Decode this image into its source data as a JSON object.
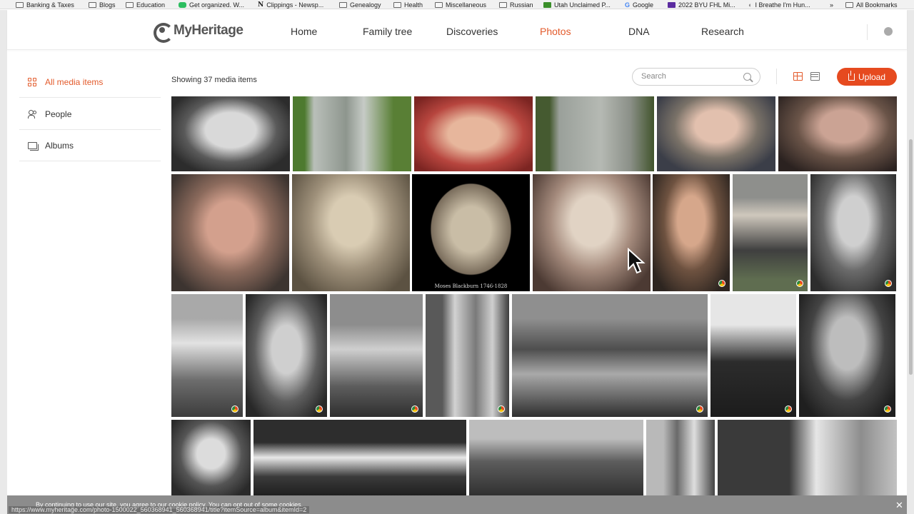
{
  "bookmarks": [
    {
      "label": "Banking & Taxes",
      "icon": "folder-icon"
    },
    {
      "label": "Blogs",
      "icon": "folder-icon"
    },
    {
      "label": "Education",
      "icon": "folder-icon"
    },
    {
      "label": "Get organized. W...",
      "icon": "evernote-icon"
    },
    {
      "label": "Clippings - Newsp...",
      "icon": "newspapers-icon"
    },
    {
      "label": "Genealogy",
      "icon": "folder-icon"
    },
    {
      "label": "Health",
      "icon": "folder-icon"
    },
    {
      "label": "Miscellaneous",
      "icon": "folder-icon"
    },
    {
      "label": "Russian",
      "icon": "folder-icon"
    },
    {
      "label": "Utah Unclaimed P...",
      "icon": "utah-icon"
    },
    {
      "label": "Google",
      "icon": "google-icon"
    },
    {
      "label": "2022 BYU FHL Mi...",
      "icon": "byu-icon"
    },
    {
      "label": "I Breathe I'm Hun...",
      "icon": "site-icon"
    },
    {
      "label": "»",
      "icon": ""
    },
    {
      "label": "All Bookmarks",
      "icon": "folder-icon"
    }
  ],
  "header": {
    "brand": "MyHeritage",
    "nav": [
      {
        "label": "Home",
        "active": false
      },
      {
        "label": "Family tree",
        "active": false
      },
      {
        "label": "Discoveries",
        "active": false
      },
      {
        "label": "Photos",
        "active": true
      },
      {
        "label": "DNA",
        "active": false
      },
      {
        "label": "Research",
        "active": false
      }
    ]
  },
  "sidebar": {
    "items": [
      {
        "label": "All media items",
        "icon": "grid-icon",
        "active": true
      },
      {
        "label": "People",
        "icon": "people-icon",
        "active": false
      },
      {
        "label": "Albums",
        "icon": "albums-icon",
        "active": false
      }
    ]
  },
  "toolbar": {
    "showing_text": "Showing 37 media items",
    "search_placeholder": "Search",
    "upload_label": "Upload"
  },
  "photos": [
    {
      "caption": "",
      "colorized": false,
      "tone": "bw-portrait"
    },
    {
      "caption": "",
      "colorized": false,
      "tone": "gravestone"
    },
    {
      "caption": "",
      "colorized": false,
      "tone": "color-child"
    },
    {
      "caption": "",
      "colorized": false,
      "tone": "gravestone-text"
    },
    {
      "caption": "",
      "colorized": false,
      "tone": "color-old-man"
    },
    {
      "caption": "",
      "colorized": false,
      "tone": "color-woman"
    },
    {
      "caption": "",
      "colorized": false,
      "tone": "color-man-glasses"
    },
    {
      "caption": "",
      "colorized": false,
      "tone": "sepia-old-man"
    },
    {
      "caption": "Moses Blackburn 1746-1828",
      "colorized": false,
      "tone": "oval-portrait"
    },
    {
      "caption": "",
      "colorized": false,
      "tone": "sepia-old-woman"
    },
    {
      "caption": "",
      "colorized": true,
      "tone": "color-young-woman"
    },
    {
      "caption": "",
      "colorized": true,
      "tone": "color-standing-woman"
    },
    {
      "caption": "",
      "colorized": true,
      "tone": "bw-man"
    },
    {
      "caption": "",
      "colorized": true,
      "tone": "bw-child"
    },
    {
      "caption": "",
      "colorized": true,
      "tone": "bw-soldier"
    },
    {
      "caption": "",
      "colorized": true,
      "tone": "bw-boy-chair"
    },
    {
      "caption": "",
      "colorized": true,
      "tone": "bw-family"
    },
    {
      "caption": "",
      "colorized": true,
      "tone": "bw-car-group"
    },
    {
      "caption": "",
      "colorized": true,
      "tone": "bw-three-people"
    },
    {
      "caption": "",
      "colorized": true,
      "tone": "bw-bearded-man"
    },
    {
      "caption": "",
      "colorized": false,
      "tone": "bw-young-woman"
    },
    {
      "caption": "",
      "colorized": false,
      "tone": "bw-trees"
    },
    {
      "caption": "",
      "colorized": false,
      "tone": "bw-large-family"
    },
    {
      "caption": "",
      "colorized": false,
      "tone": "bw-couple"
    },
    {
      "caption": "",
      "colorized": false,
      "tone": "bw-seated-man"
    }
  ],
  "cookie_bar": {
    "text_before": "By continuing to use our site, you agree to our ",
    "link": "cookie policy",
    "text_after": ". You can opt out of some cookies.",
    "close": "✕"
  },
  "status_url": "https://www.myheritage.com/photo-1500022_560368941_560368941/title?itemSource=album&itemId=2",
  "colors": {
    "accent": "#e35b2c",
    "upload": "#e64a1f"
  }
}
